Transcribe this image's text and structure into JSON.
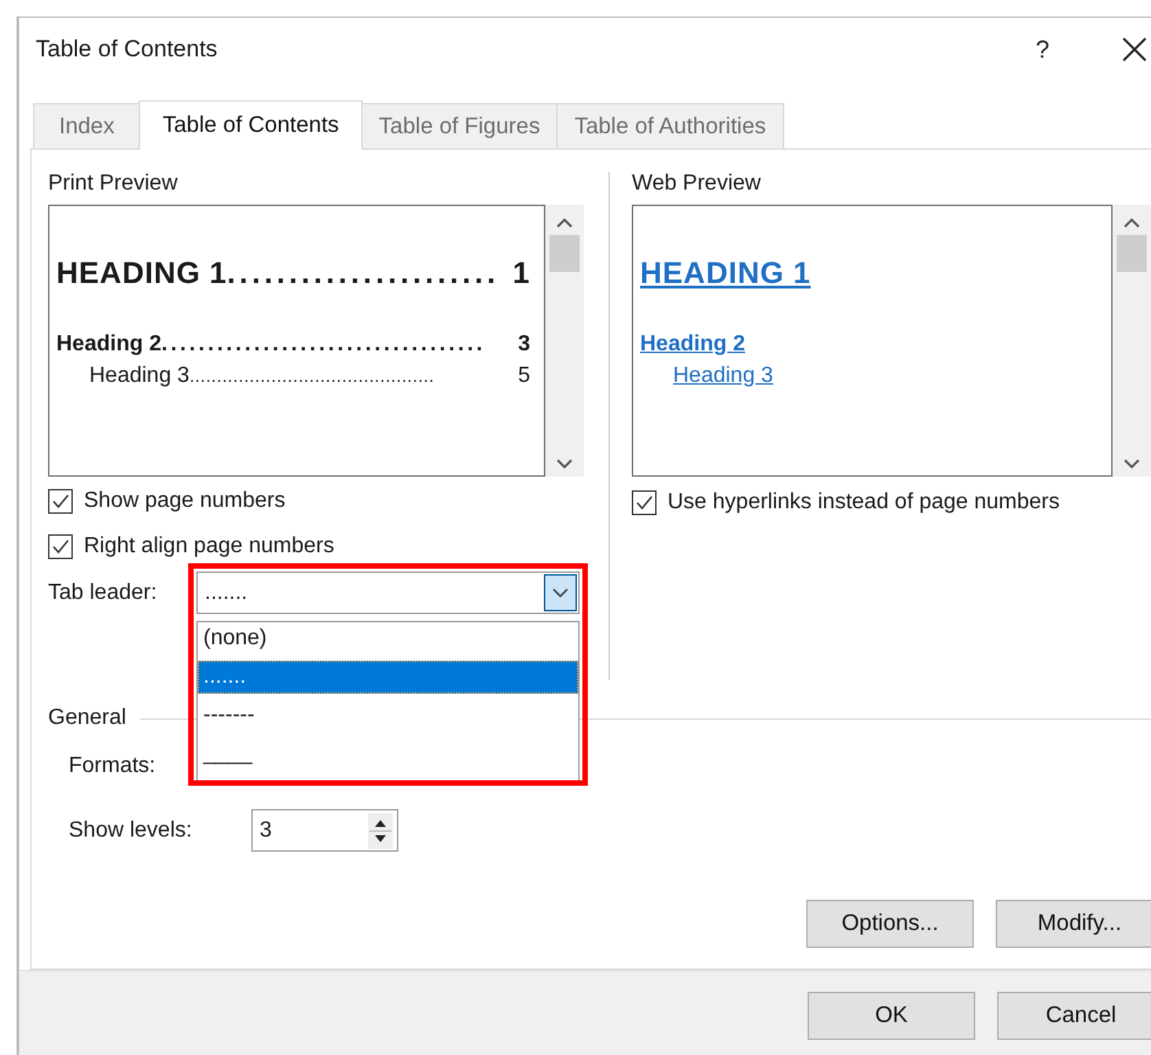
{
  "dialog": {
    "title": "Table of Contents",
    "help": "?"
  },
  "tabs": [
    {
      "label": "Index",
      "selected": false
    },
    {
      "label": "Table of Contents",
      "selected": true
    },
    {
      "label": "Table of Figures",
      "selected": false
    },
    {
      "label": "Table of Authorities",
      "selected": false
    }
  ],
  "print_preview": {
    "label": "Print Preview",
    "entries": [
      {
        "kind": "h1",
        "text": "HEADING 1",
        "leader": "......................",
        "page": "1"
      },
      {
        "kind": "h2",
        "text": "Heading 2",
        "leader": "...................................",
        "page": "3"
      },
      {
        "kind": "h3",
        "text": "Heading 3",
        "leader": ".............................................",
        "page": "5"
      }
    ]
  },
  "web_preview": {
    "label": "Web Preview",
    "entries": [
      {
        "kind": "h1",
        "text": "HEADING 1"
      },
      {
        "kind": "h2",
        "text": "Heading 2"
      },
      {
        "kind": "h3",
        "text": "Heading 3"
      }
    ]
  },
  "print_options": [
    {
      "label": "Show page numbers",
      "checked": true
    },
    {
      "label": "Right align page numbers",
      "checked": true
    }
  ],
  "web_options": [
    {
      "label": "Use hyperlinks instead of page numbers",
      "checked": true
    }
  ],
  "tab_leader": {
    "label": "Tab leader:",
    "value": ".......",
    "expanded": true,
    "options": [
      {
        "text": "(none)",
        "selected": false
      },
      {
        "text": ".......",
        "selected": true
      },
      {
        "text": "-------",
        "selected": false
      },
      {
        "text": "____",
        "selected": false
      }
    ]
  },
  "general": {
    "label": "General",
    "formats_label": "Formats:",
    "show_levels_label": "Show levels:",
    "show_levels_value": "3"
  },
  "panel_buttons": [
    "Options...",
    "Modify..."
  ],
  "footer_buttons": [
    "OK",
    "Cancel"
  ]
}
